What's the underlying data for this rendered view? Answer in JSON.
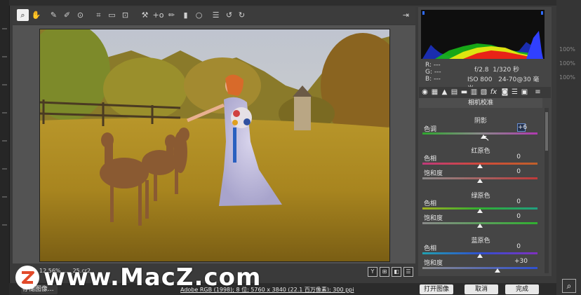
{
  "toolbar": {
    "tools": [
      "zoom-tool",
      "hand-tool",
      "white-balance-tool",
      "color-sampler-tool",
      "target-adjust-tool",
      "crop-tool",
      "straighten-tool",
      "transform-tool",
      "spot-removal-tool",
      "red-eye-tool",
      "adjustment-brush-tool",
      "graduated-filter-tool",
      "radial-filter-tool",
      "preferences",
      "rotate-ccw",
      "rotate-cw"
    ],
    "fullscreen_icon": "fullscreen-icon"
  },
  "camera_info": {
    "r_label": "R:",
    "r_value": "---",
    "g_label": "G:",
    "g_value": "---",
    "b_label": "B:",
    "b_value": "---",
    "aperture": "f/2.8",
    "shutter": "1/320 秒",
    "iso": "ISO 800",
    "lens": "24-70@30 毫米"
  },
  "panel": {
    "section_title": "相机校准",
    "shadows": {
      "title": "阴影",
      "tint_label": "色调",
      "tint_value": "+6",
      "tint_pct": 0.53
    },
    "red": {
      "title": "红原色",
      "hue_label": "色相",
      "hue_value": "0",
      "hue_pct": 0.5,
      "sat_label": "饱和度",
      "sat_value": "0",
      "sat_pct": 0.5
    },
    "green": {
      "title": "绿原色",
      "hue_label": "色相",
      "hue_value": "0",
      "hue_pct": 0.5,
      "sat_label": "饱和度",
      "sat_value": "0",
      "sat_pct": 0.5
    },
    "blue": {
      "title": "蓝原色",
      "hue_label": "色相",
      "hue_value": "0",
      "hue_pct": 0.5,
      "sat_label": "饱和度",
      "sat_value": "+30",
      "sat_pct": 0.65
    }
  },
  "bottom": {
    "filename": "12.56%   …  _25.cr2",
    "view_buttons": [
      "Y",
      "⊞",
      "◧",
      "☰"
    ]
  },
  "status": {
    "save_label": "存储图像...",
    "workflow": "Adobe RGB (1998); 8 位; 5760 x 3840 (22.1 百万像素); 300 ppi",
    "open_label": "打开图像",
    "cancel_label": "取消",
    "done_label": "完成"
  },
  "watermark": {
    "text": "www.MacZ.com"
  },
  "ps_right": {
    "values": [
      "100%",
      "100%",
      "100%"
    ]
  },
  "colors": {
    "accent": "#e8e8e8",
    "panel": "#454545",
    "photo_sky": "#c8c8d0",
    "grass": "#c89a2a"
  }
}
